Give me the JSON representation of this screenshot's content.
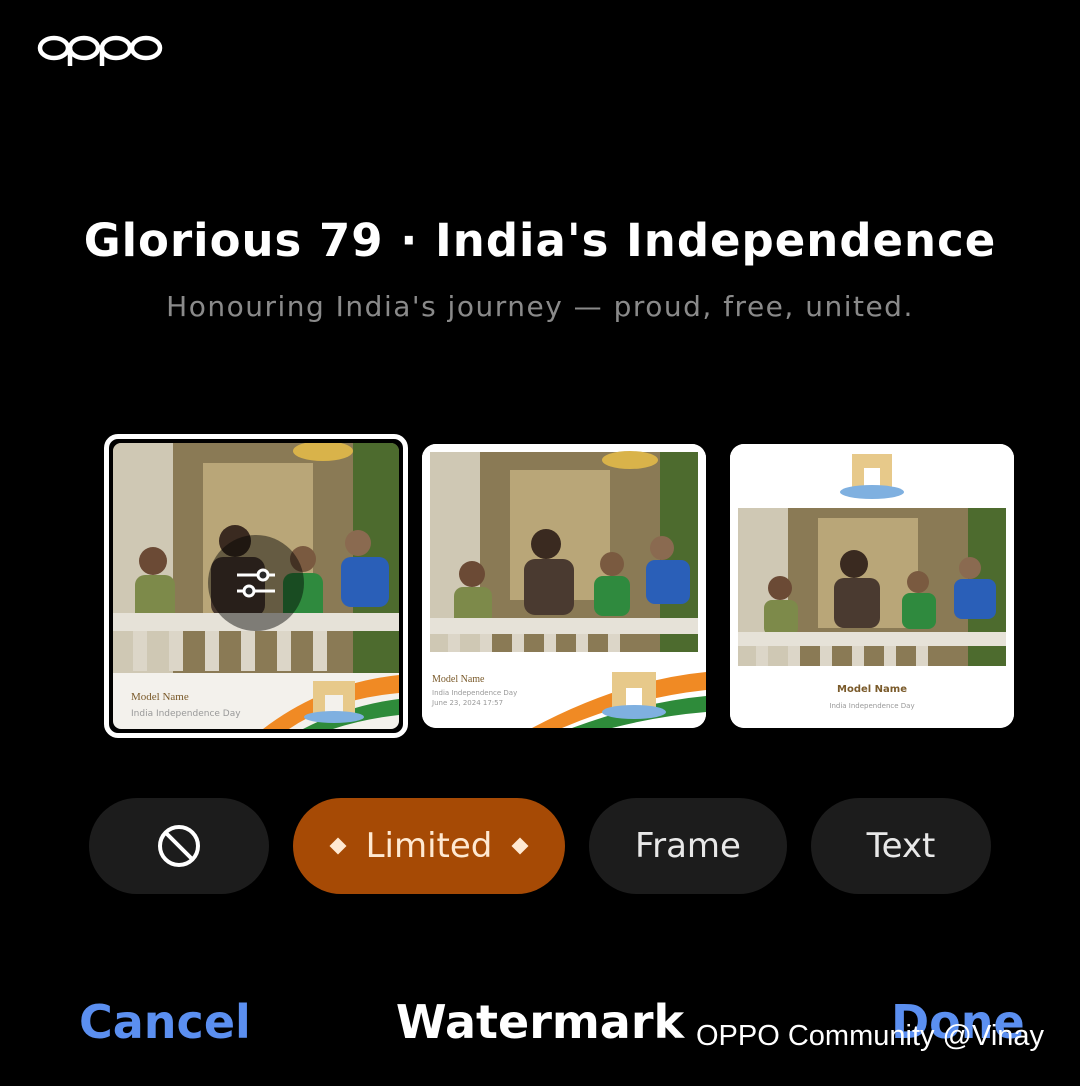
{
  "brand": {
    "logo": "oppo"
  },
  "header": {
    "title": "Glorious 79 · India's Independence",
    "subtitle": "Honouring India's journey — proud, free, united."
  },
  "templates": [
    {
      "id": "overlay",
      "selected": true,
      "caption_title": "Model Name",
      "caption_sub": "India Independence Day"
    },
    {
      "id": "bottom-band",
      "selected": false,
      "caption_title": "Model Name",
      "caption_sub": "India Independence Day",
      "caption_date": "June 23, 2024 17:57"
    },
    {
      "id": "frame-top-gate",
      "selected": false,
      "caption_title": "Model Name",
      "caption_sub": "India Independence Day"
    }
  ],
  "options": [
    {
      "id": "none",
      "icon": "prohibited-icon"
    },
    {
      "id": "limited",
      "label": "Limited",
      "active": true
    },
    {
      "id": "frame",
      "label": "Frame"
    },
    {
      "id": "text",
      "label": "Text"
    }
  ],
  "footer": {
    "cancel_label": "Cancel",
    "title": "Watermark",
    "done_label": "Done"
  },
  "credit": "OPPO Community @Vinay",
  "colors": {
    "accent": "#a64a05",
    "link": "#5b8ff0",
    "saffron": "#f08a24",
    "green": "#2e8b3a"
  }
}
